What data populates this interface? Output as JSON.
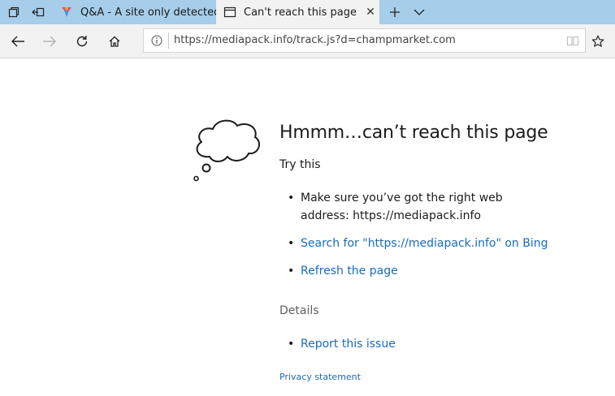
{
  "tabs": [
    {
      "title": "Q&A - A site only detected",
      "active": false,
      "icon": "qa-favicon"
    },
    {
      "title": "Can't reach this page",
      "active": true,
      "icon": "page-icon"
    }
  ],
  "toolbar": {
    "url": "https://mediapack.info/track.js?d=champmarket.com"
  },
  "error_page": {
    "heading": "Hmmm…can’t reach this page",
    "try_this": "Try this",
    "suggestion_1_line1": "Make sure you’ve got the right web",
    "suggestion_1_line2": "address: https://mediapack.info",
    "search_link": "Search for \"https://mediapack.info\" on Bing",
    "refresh_link": "Refresh the page",
    "details": "Details",
    "report_link": "Report this issue",
    "privacy_link": "Privacy statement",
    "bullet": "•"
  },
  "colors": {
    "tabstrip": "#a6cdea",
    "toolbar": "#f2f2f2",
    "link": "#1a6bbf"
  }
}
